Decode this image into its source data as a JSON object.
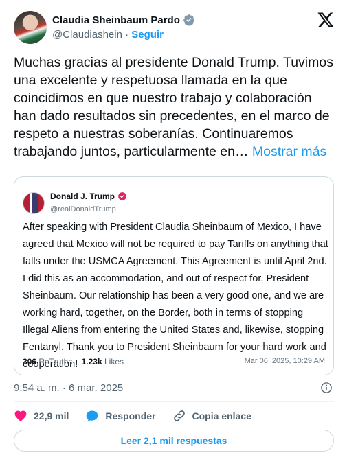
{
  "author": {
    "name": "Claudia Sheinbaum Pardo",
    "handle": "@Claudiashein",
    "separator": "·",
    "follow_label": "Seguir"
  },
  "tweet": {
    "text": "Muchas gracias al presidente Donald Trump. Tuvimos una excelente y respetuosa llamada en la que coincidimos en que nuestro trabajo y colaboración han dado resultados sin precedentes, en el marco de respeto a nuestras soberanías. Continuaremos trabajando juntos, particularmente en…",
    "show_more": "Mostrar más"
  },
  "quote": {
    "name": "Donald J. Trump",
    "handle": "@realDonaldTrump",
    "text": "After speaking with President Claudia Sheinbaum of Mexico, I have agreed that Mexico will not be required to pay Tariffs on anything that falls under the USMCA Agreement. This Agreement is until April 2nd. I did this as an accommodation, and out of respect for, President Sheinbaum. Our relationship has been a very good one, and we are working hard, together, on the Border, both in terms of stopping Illegal Aliens from entering the United States and, likewise, stopping Fentanyl. Thank you to President Sheinbaum for your hard work and cooperation!",
    "retruths_count": "306",
    "retruths_label": "ReTruths",
    "likes_count": "1.23k",
    "likes_label": "Likes",
    "date": "Mar 06, 2025, 10:29 AM"
  },
  "timestamp": "9:54 a. m. · 6 mar. 2025",
  "actions": {
    "likes_count": "22,9 mil",
    "reply_label": "Responder",
    "copy_link_label": "Copia enlace"
  },
  "read_replies_label": "Leer 2,1 mil respuestas",
  "colors": {
    "accent": "#1d9bf0",
    "like": "#f91880",
    "text": "#0f1419",
    "muted": "#536471"
  }
}
